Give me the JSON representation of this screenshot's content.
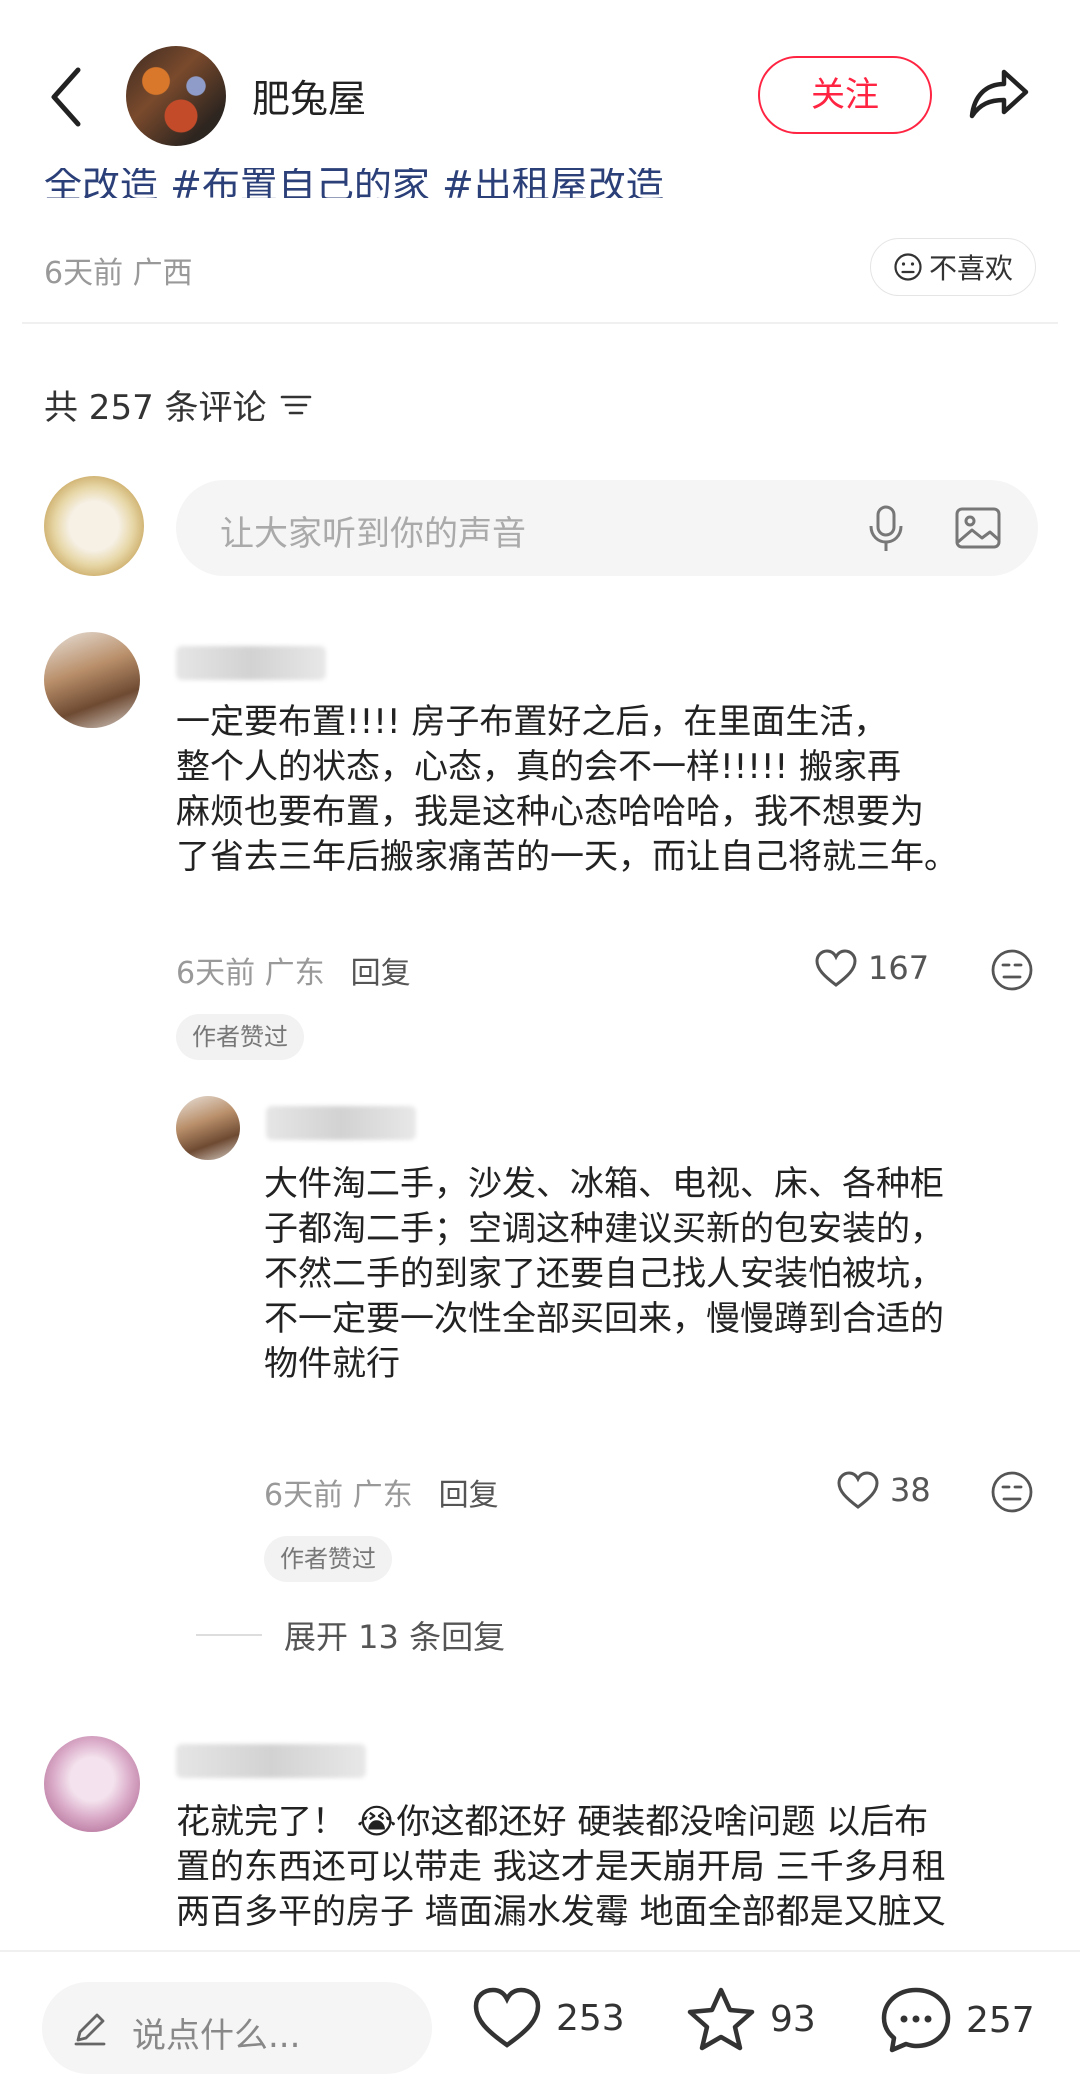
{
  "header": {
    "author_name": "肥兔屋",
    "follow_label": "关注"
  },
  "post": {
    "tags_line": "全改造 #布置自己的家 #出租屋改造",
    "time_location": "6天前 广西",
    "dislike_label": "不喜欢"
  },
  "comments_header": {
    "count_label": "共 257 条评论"
  },
  "comment_input": {
    "placeholder": "让大家听到你的声音"
  },
  "comments": [
    {
      "text_lines": [
        "一定要布置!!!! 房子布置好之后，在里面生活，",
        "整个人的状态，心态，真的会不一样!!!!! 搬家再",
        "麻烦也要布置，我是这种心态哈哈哈，我不想要为",
        "了省去三年后搬家痛苦的一天，而让自己将就三年。"
      ],
      "time_location": "6天前 广东",
      "reply_label": "回复",
      "likes": "167",
      "badge": "作者赞过"
    },
    {
      "text_lines": [
        "大件淘二手，沙发、冰箱、电视、床、各种柜",
        "子都淘二手；空调这种建议买新的包安装的，",
        "不然二手的到家了还要自己找人安装怕被坑，",
        "不一定要一次性全部买回来，慢慢蹲到合适的",
        "物件就行"
      ],
      "time_location": "6天前 广东",
      "reply_label": "回复",
      "likes": "38",
      "badge": "作者赞过"
    },
    {
      "text_lines": [
        "花就完了！ 😭你这都还好 硬装都没啥问题 以后布",
        "置的东西还可以带走 我这才是天崩开局 三千多月租",
        "两百多平的房子 墙面漏水发霉 地面全部都是又脏又"
      ]
    }
  ],
  "expand_label": "展开 13 条回复",
  "bottom_bar": {
    "input_placeholder": "说点什么...",
    "likes": "253",
    "favorites": "93",
    "comments": "257"
  },
  "colors": {
    "accent": "#ff2442",
    "tag_blue": "#2b3f78",
    "meta_gray": "#999999"
  }
}
